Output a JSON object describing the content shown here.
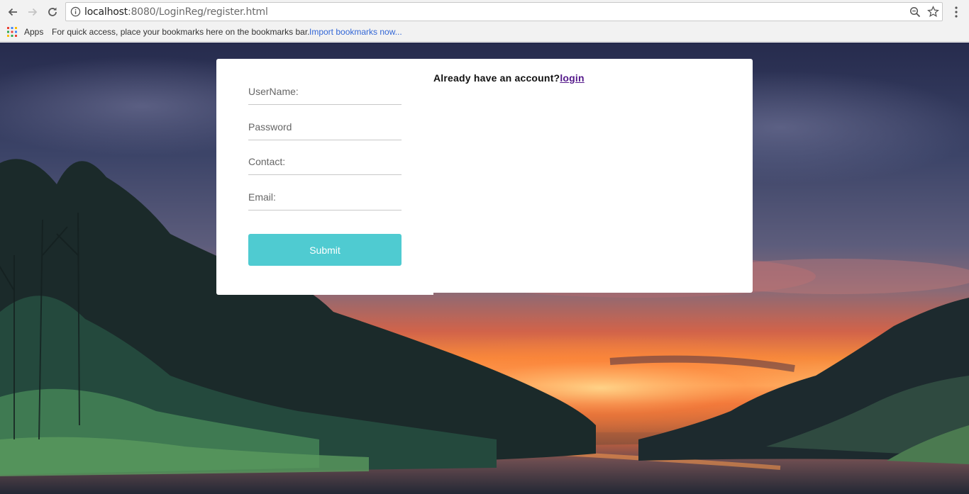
{
  "browser": {
    "url_host": "localhost",
    "url_rest": ":8080/LoginReg/register.html",
    "bookmarks": {
      "apps_label": "Apps",
      "hint": "For quick access, place your bookmarks here on the bookmarks bar.",
      "import_link": "Import bookmarks now..."
    },
    "icons": [
      "back-arrow-icon",
      "forward-arrow-icon",
      "reload-icon",
      "info-icon",
      "zoom-icon",
      "star-icon",
      "menu-kebab-icon",
      "apps-grid-icon"
    ]
  },
  "form": {
    "username_placeholder": "UserName:",
    "password_placeholder": "Password",
    "contact_placeholder": "Contact:",
    "email_placeholder": "Email:",
    "submit_label": "Submit",
    "accent_color": "#4fcbd1"
  },
  "side": {
    "prompt": "Already have an account?",
    "login_link": "login"
  }
}
